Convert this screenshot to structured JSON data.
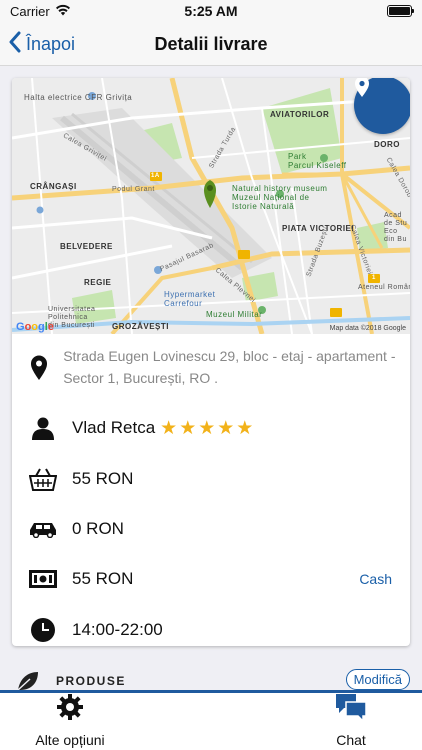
{
  "status_bar": {
    "carrier": "Carrier",
    "time": "5:25 AM"
  },
  "nav": {
    "back_label": "Înapoi",
    "title": "Detalii livrare"
  },
  "map": {
    "labels": {
      "station": "Halta\nelectrice CFR Grivița",
      "aviatorilor": "AVIATORILOR",
      "dorobanti": "DORO",
      "park": "Park\nParcul Kiseleff",
      "crangasi": "CRÂNGAȘI",
      "museum": "Natural history museum\nMuzeul Național de\nIstorie Naturală",
      "belvedere": "BELVEDERE",
      "piata_victoriei": "PIATA VICTORIEI",
      "regie": "REGIE",
      "hypermarket": "Hypermarket\nCarrefour",
      "university": "Universitatea\nPolitehnica\ndin București",
      "grozavesti": "GROZĂVEȘTI",
      "muzeul_militar": "Muzeul Militar",
      "academy": "Acad\nde Stu\nEco\ndin Bu",
      "roman": "Ateneul Român",
      "calea_grivitei": "Calea Griviței",
      "podul_grant": "Podul Grant",
      "strada_turda": "Strada Turda",
      "pasajul_basarab": "Pasajul Basarab",
      "calea_plevnei": "Calea Plevnei",
      "strada_buzesti": "Strada Buzești",
      "calea_victoriei": "Calea Victoriei",
      "calea_dorob": "Calea Dorob",
      "route_1a": "1A",
      "route_1": "1"
    },
    "attribution": "Map data ©2018 Google",
    "google_logo": "Google",
    "location_icon": "map-pin-icon"
  },
  "details": {
    "address": "Strada Eugen Lovinescu 29, bloc - etaj - apartament - Sector 1, București, RO .",
    "courier_name": "Vlad Retca",
    "rating": 5,
    "stars_text": "★★★★★",
    "products_total": "55 RON",
    "delivery_fee": "0 RON",
    "total": "55 RON",
    "payment_method": "Cash",
    "time_slot": "14:00-22:00"
  },
  "products": {
    "section_label": "PRODUSE",
    "modify_label": "Modifică"
  },
  "tabs": [
    {
      "label": "Alte opțiuni",
      "icon": "gear-icon"
    },
    {
      "label": "Chat",
      "icon": "chat-icon"
    }
  ],
  "colors": {
    "accent": "#1f5a9e",
    "link": "#1a5fa8",
    "star": "#f2b21a",
    "map_bg": "#ececec",
    "road_yellow": "#f7d27a"
  }
}
